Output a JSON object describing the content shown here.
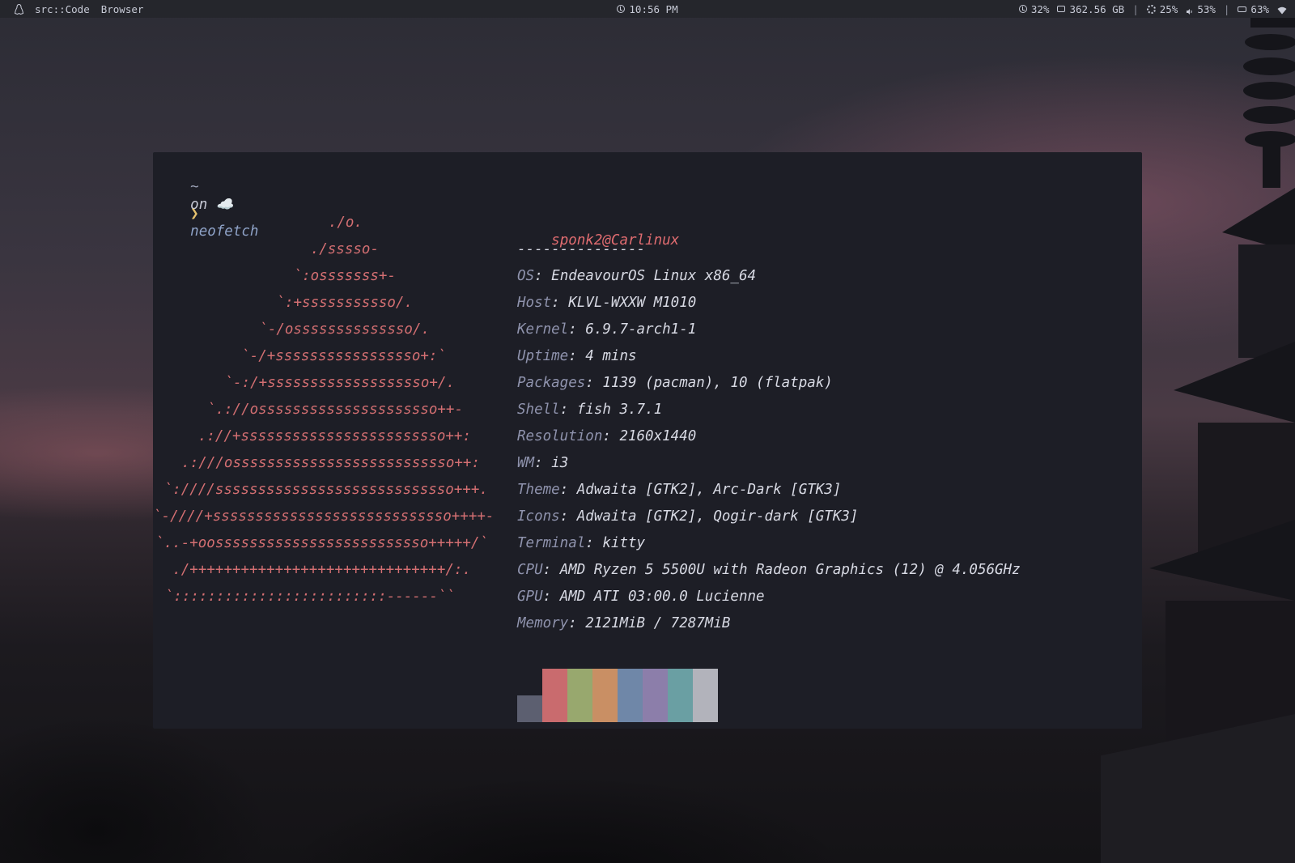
{
  "topbar": {
    "workspace_label": "src::Code",
    "browser_label": "Browser",
    "time": "10:56 PM",
    "cpu": "32%",
    "disk": "362.56 GB",
    "brightness": "25%",
    "volume": "53%",
    "battery": "63%"
  },
  "terminal": {
    "prompt_tilde": "~",
    "prompt_on": "on ☁️",
    "prompt_arrow": "❯",
    "command": "neofetch",
    "ascii": [
      "./o.",
      "./sssso-",
      "`:osssssss+-",
      "`:+sssssssssso/.",
      "`-/ossssssssssssso/.",
      "`-/+sssssssssssssssso+:`",
      "`-:/+sssssssssssssssssso+/.",
      "`.://osssssssssssssssssssso++-",
      ".://+ssssssssssssssssssssssso++:",
      ".:///ossssssssssssssssssssssssso++:",
      "`:////ssssssssssssssssssssssssssso+++.",
      "`-////+ssssssssssssssssssssssssssso++++-",
      "`..-+oosssssssssssssssssssssssso+++++/`",
      "./++++++++++++++++++++++++++++++/:.",
      "`:::::::::::::::::::::::::------``"
    ],
    "user": "sponk2",
    "at": "@",
    "host": "Carlinux",
    "divider": "---------------",
    "info": [
      {
        "key": "OS",
        "val": "EndeavourOS Linux x86_64"
      },
      {
        "key": "Host",
        "val": "KLVL-WXXW M1010"
      },
      {
        "key": "Kernel",
        "val": "6.9.7-arch1-1"
      },
      {
        "key": "Uptime",
        "val": "4 mins"
      },
      {
        "key": "Packages",
        "val": "1139 (pacman), 10 (flatpak)"
      },
      {
        "key": "Shell",
        "val": "fish 3.7.1"
      },
      {
        "key": "Resolution",
        "val": "2160x1440"
      },
      {
        "key": "WM",
        "val": "i3"
      },
      {
        "key": "Theme",
        "val": "Adwaita [GTK2], Arc-Dark [GTK3]"
      },
      {
        "key": "Icons",
        "val": "Adwaita [GTK2], Qogir-dark [GTK3]"
      },
      {
        "key": "Terminal",
        "val": "kitty"
      },
      {
        "key": "CPU",
        "val": "AMD Ryzen 5 5500U with Radeon Graphics (12) @ 4.056GHz"
      },
      {
        "key": "GPU",
        "val": "AMD ATI 03:00.0 Lucienne"
      },
      {
        "key": "Memory",
        "val": "2121MiB / 7287MiB"
      }
    ],
    "palette_top": [
      "#1d1e26",
      "#c96b6e",
      "#98a86e",
      "#c98f64",
      "#6f87a8",
      "#8c7eaa",
      "#6a9fa3",
      "#b2b3bb"
    ],
    "palette_bottom": [
      "#5c5f70",
      "#c96b6e",
      "#98a86e",
      "#c98f64",
      "#6f87a8",
      "#8c7eaa",
      "#6a9fa3",
      "#b2b3bb"
    ]
  }
}
